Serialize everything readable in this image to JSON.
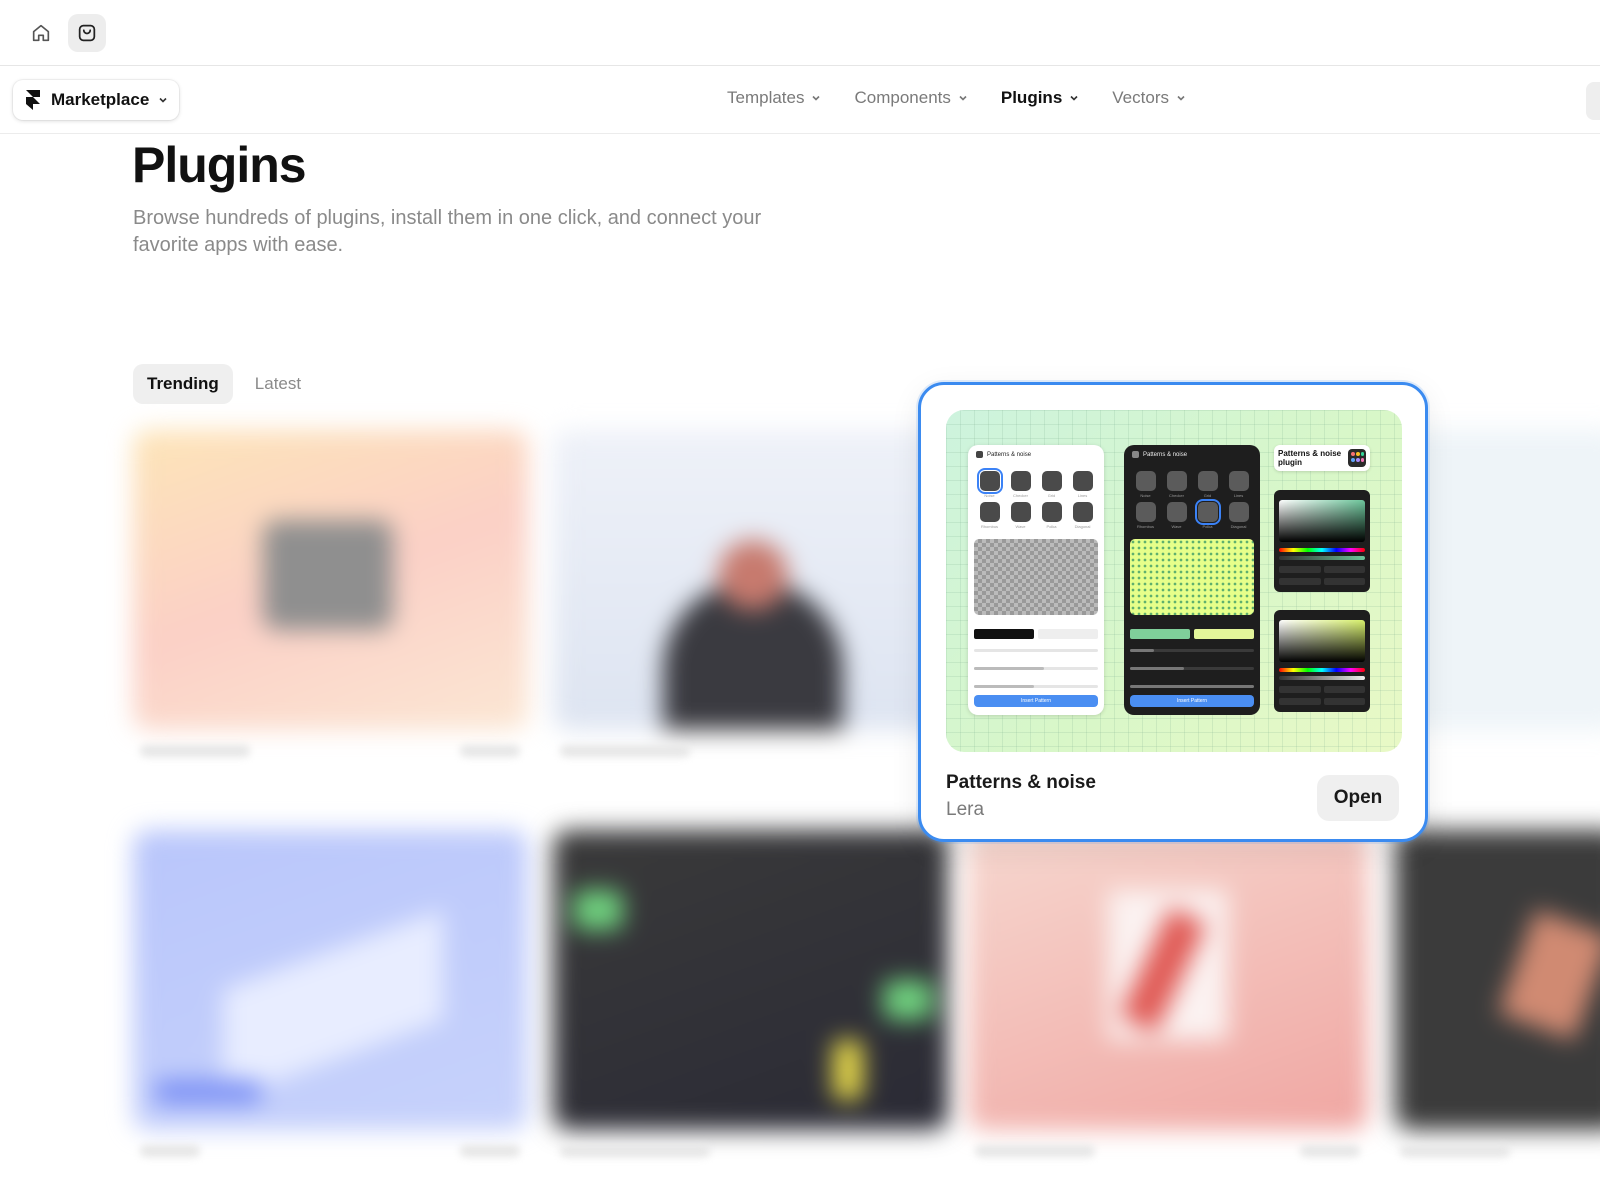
{
  "topbar": {
    "icons": [
      "home-icon",
      "shopping-bag-icon"
    ]
  },
  "brand": {
    "label": "Marketplace"
  },
  "nav": {
    "items": [
      {
        "label": "Templates"
      },
      {
        "label": "Components"
      },
      {
        "label": "Plugins",
        "active": true
      },
      {
        "label": "Vectors"
      }
    ]
  },
  "page": {
    "title": "Plugins",
    "description": "Browse hundreds of plugins, install them in one click, and connect your favorite apps with ease."
  },
  "tabs": [
    {
      "label": "Trending",
      "active": true
    },
    {
      "label": "Latest"
    }
  ],
  "featured": {
    "name": "Patterns & noise",
    "author": "Lera",
    "action": "Open",
    "preview": {
      "light_panel_title": "Patterns & noise",
      "dark_panel_title": "Patterns & noise",
      "label_box": "Patterns & noise plugin",
      "swatches": [
        "Noise",
        "Checker",
        "Grid",
        "Lines",
        "Rhombus",
        "Wave",
        "Polka",
        "Diagonal"
      ],
      "insert_label": "Insert Pattern"
    }
  },
  "colors": {
    "focus_ring": "#3b8bf0",
    "thumb_bg": "#cdf3de"
  }
}
